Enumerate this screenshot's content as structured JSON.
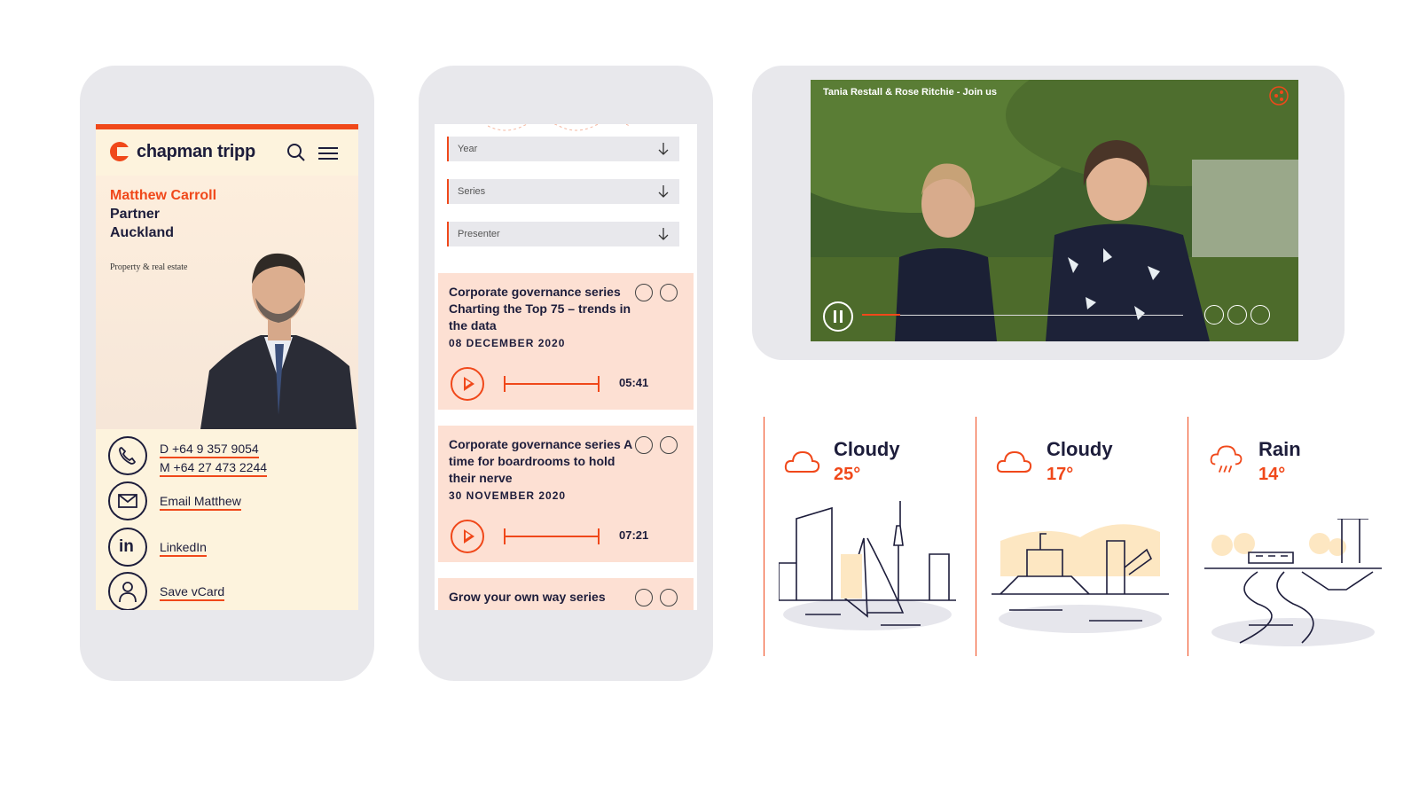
{
  "brand": {
    "name": "chapman tripp",
    "accent": "#f0481a",
    "navy": "#1d1d3b"
  },
  "profile": {
    "name": "Matthew Carroll",
    "role": "Partner",
    "city": "Auckland",
    "area": "Property & real estate",
    "phone_direct": "D +64 9 357 9054",
    "phone_mobile": "M +64 27 473 2244",
    "email_label": "Email Matthew",
    "linkedin_label": "LinkedIn",
    "vcard_label": "Save vCard"
  },
  "filters": [
    {
      "label": "Year"
    },
    {
      "label": "Series"
    },
    {
      "label": "Presenter"
    }
  ],
  "episodes": [
    {
      "title": "Corporate governance series Charting the Top 75 – trends in the data",
      "date": "08 DECEMBER 2020",
      "duration": "05:41"
    },
    {
      "title": "Corporate governance series A time for boardrooms to hold their nerve",
      "date": "30 NOVEMBER 2020",
      "duration": "07:21"
    },
    {
      "title": "Grow your own way series"
    }
  ],
  "video": {
    "title": "Tania Restall & Rose Ritchie - Join us",
    "progress": 0.12
  },
  "weather": [
    {
      "condition": "Cloudy",
      "temp": "25°",
      "icon": "cloud-icon",
      "scene": "auckland-skyline"
    },
    {
      "condition": "Cloudy",
      "temp": "17°",
      "icon": "cloud-icon",
      "scene": "wellington-harbour"
    },
    {
      "condition": "Rain",
      "temp": "14°",
      "icon": "rain-cloud-icon",
      "scene": "christchurch-river"
    }
  ]
}
